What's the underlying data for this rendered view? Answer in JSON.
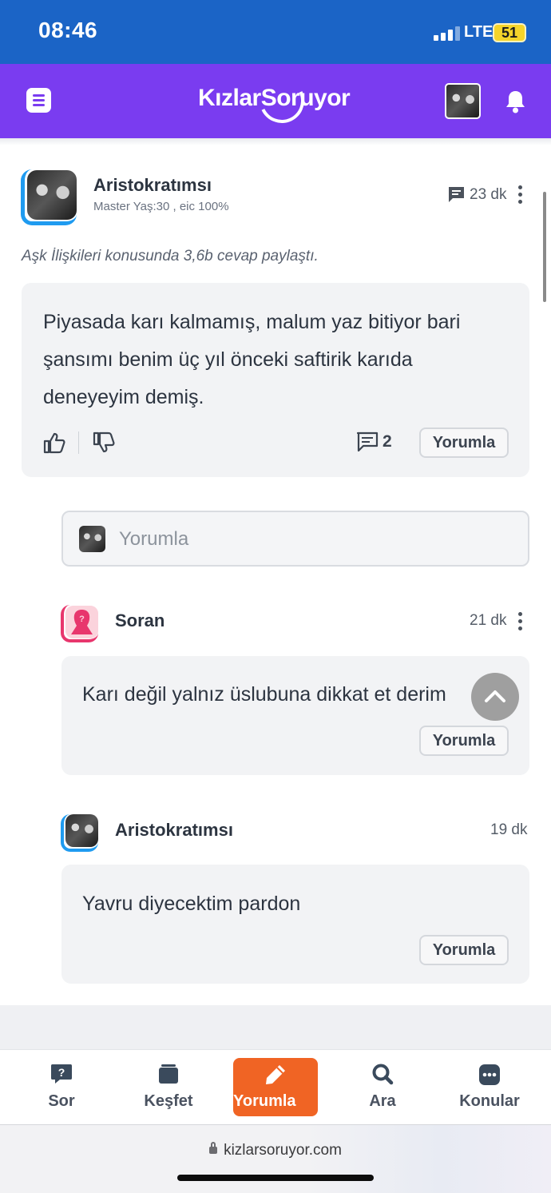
{
  "status_bar": {
    "time": "08:46",
    "network": "LTE",
    "battery": "51"
  },
  "header": {
    "logo": "KızlarSoruyor",
    "menu_icon": "menu-icon",
    "bell_icon": "bell-icon"
  },
  "post": {
    "author": "Aristokratımsı",
    "meta": "Master Yaş:30 , eic 100%",
    "time": "23 dk",
    "activity": "Aşk İlişkileri konusunda 3,6b cevap paylaştı.",
    "text": "Piyasada karı kalmamış, malum yaz bitiyor bari şansımı benim üç yıl önceki saftirik karıda deneyeyim demiş.",
    "comment_count": "2",
    "reply_label": "Yorumla"
  },
  "comment_input": {
    "placeholder": "Yorumla"
  },
  "replies": [
    {
      "author": "Soran",
      "time": "21 dk",
      "text": "Karı değil yalnız üslubuna dikkat et derim",
      "reply_label": "Yorumla"
    },
    {
      "author": "Aristokratımsı",
      "time": "19 dk",
      "text": "Yavru diyecektim pardon",
      "reply_label": "Yorumla"
    }
  ],
  "bottom_nav": [
    {
      "label": "Sor",
      "icon": "question-bubble-icon"
    },
    {
      "label": "Keşfet",
      "icon": "cards-icon"
    },
    {
      "label": "Yorumla",
      "icon": "pencil-icon",
      "active": true
    },
    {
      "label": "Ara",
      "icon": "search-icon"
    },
    {
      "label": "Konular",
      "icon": "dots-bubble-icon"
    }
  ],
  "browser": {
    "url": "kizlarsoruyor.com"
  },
  "colors": {
    "status_bar": "#1b64c6",
    "header": "#7a3cf0",
    "accent_orange": "#f06424",
    "blue_ring": "#1f9bf0",
    "pink_ring": "#e8366d"
  }
}
